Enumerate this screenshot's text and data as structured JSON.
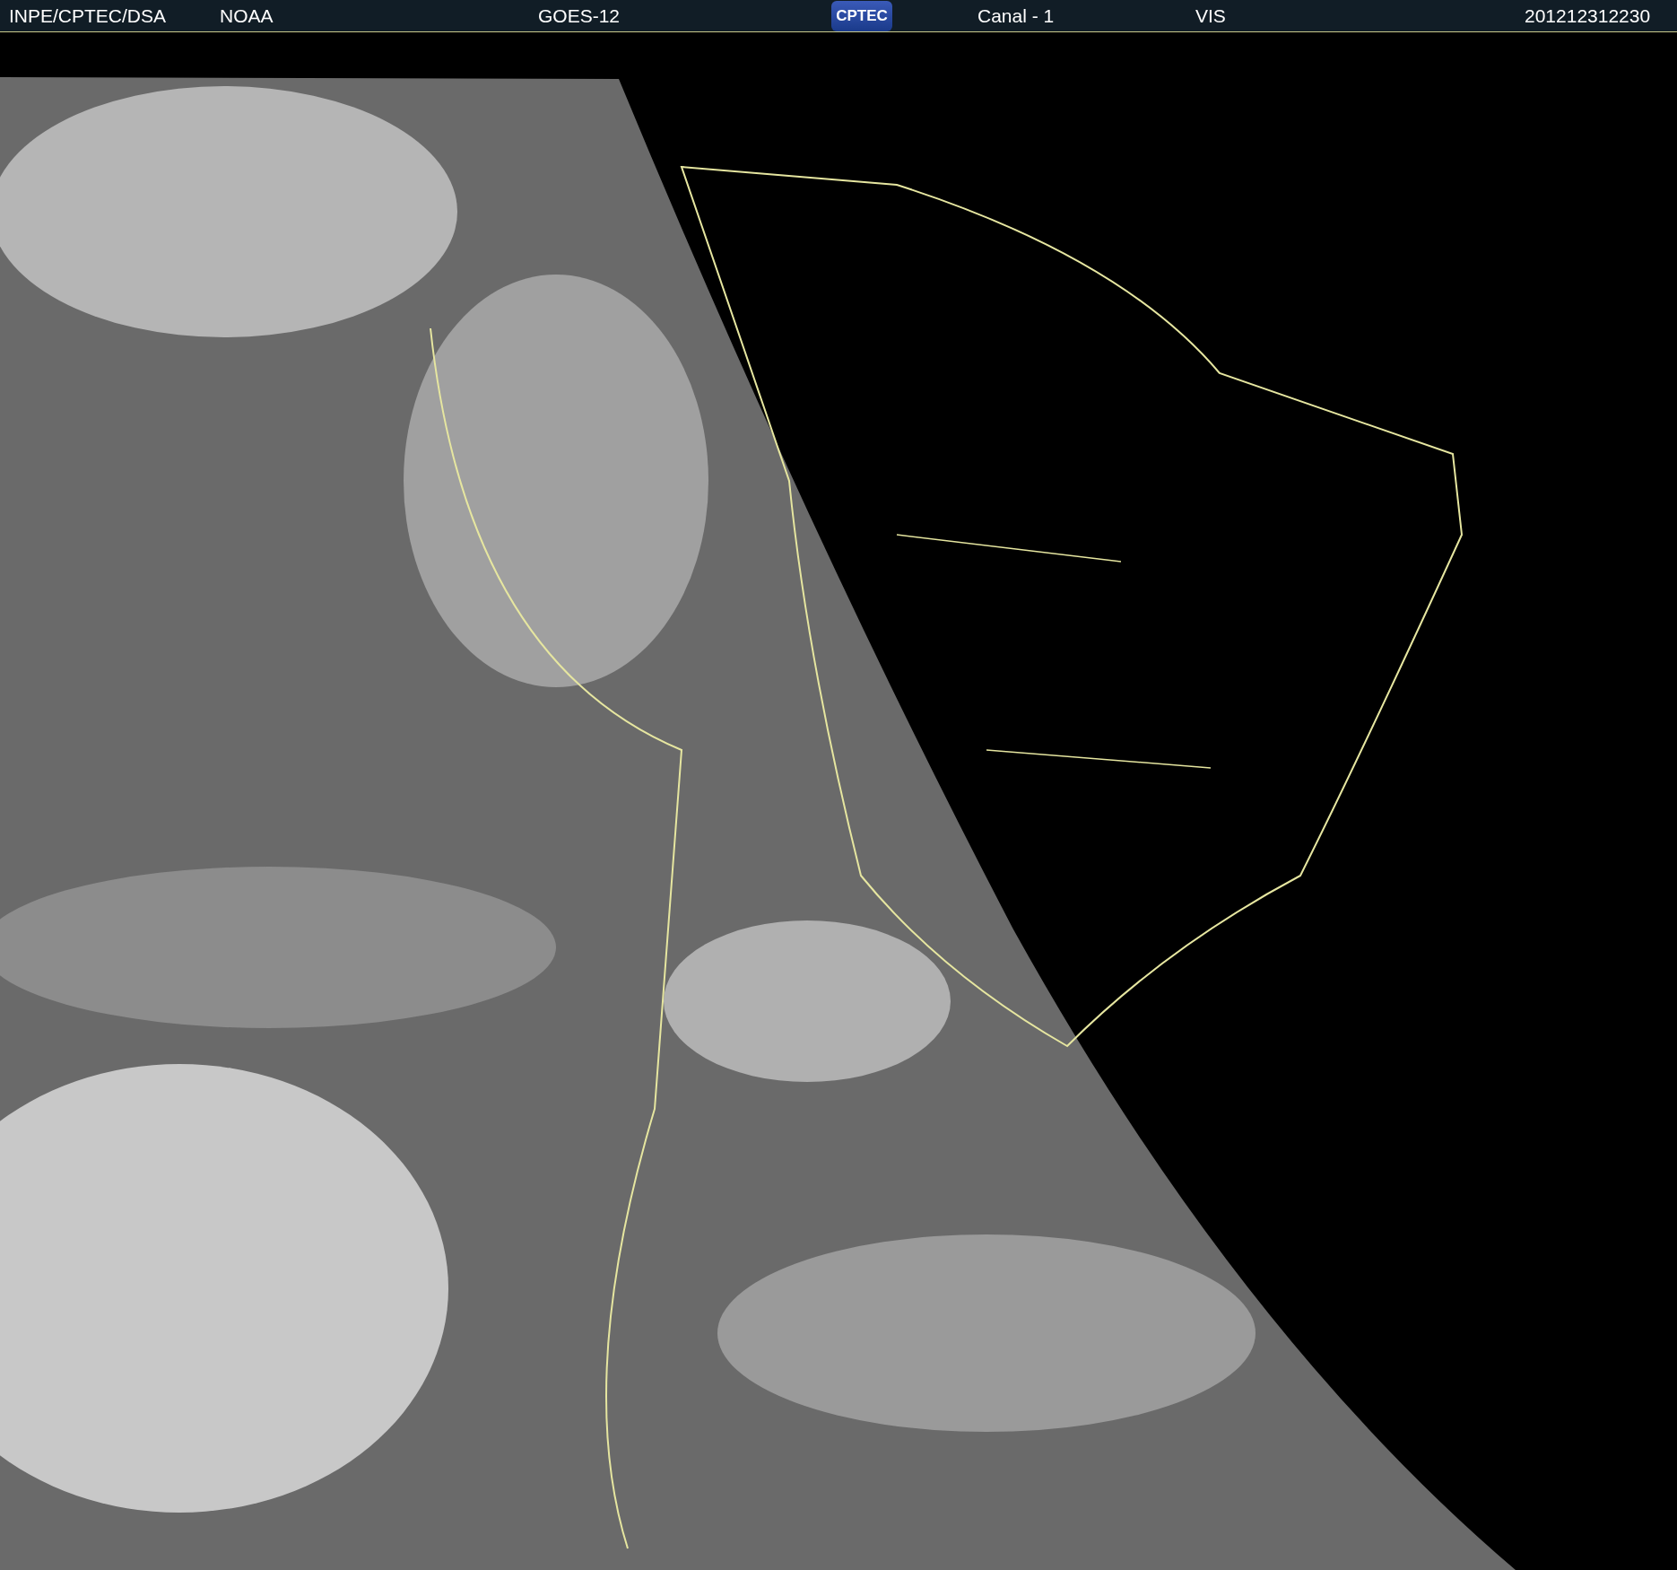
{
  "header": {
    "source": "INPE/CPTEC/DSA",
    "agency": "NOAA",
    "satellite": "GOES-12",
    "logo_text": "CPTEC",
    "channel": "Canal - 1",
    "band": "VIS",
    "timestamp": "201212312230"
  }
}
